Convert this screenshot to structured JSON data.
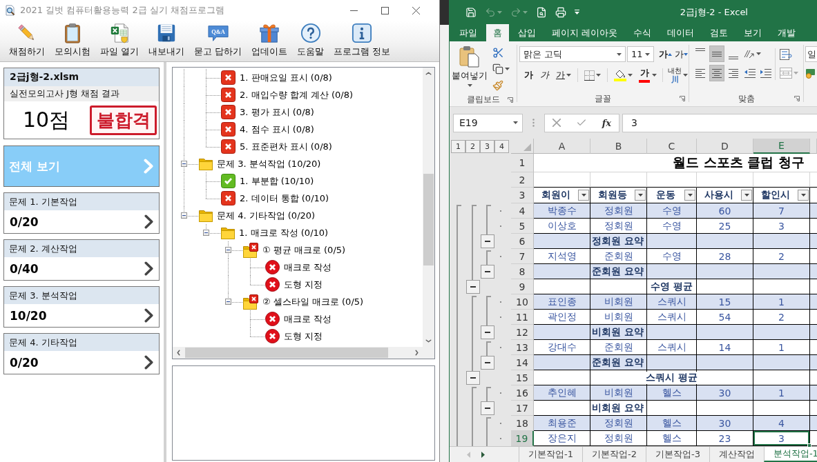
{
  "app": {
    "title": "2021 길벗 컴퓨터활용능력 2급 실기 채점프로그램",
    "toolbar": [
      {
        "kind": "pencil",
        "label": "채점하기"
      },
      {
        "kind": "clipboard",
        "label": "모의시험"
      },
      {
        "kind": "spreadsheet",
        "label": "파일 열기"
      },
      {
        "kind": "disk",
        "label": "내보내기"
      },
      {
        "kind": "qa",
        "icon_text": "Q&A",
        "label": "묻고 답하기"
      },
      {
        "kind": "gift",
        "label": "업데이트"
      },
      {
        "kind": "help",
        "label": "도움말"
      },
      {
        "kind": "info",
        "label": "프로그램 정보"
      }
    ],
    "result": {
      "file": "2급j형-2.xlsm",
      "subtitle": "실전모의고사 J형 채점 결과",
      "score": "10점",
      "stamp": "불합격"
    },
    "overview": "전체 보기",
    "sections": [
      {
        "title": "문제 1. 기본작업",
        "score": "0/20"
      },
      {
        "title": "문제 2. 계산작업",
        "score": "0/40"
      },
      {
        "title": "문제 3. 분석작업",
        "score": "10/20"
      },
      {
        "title": "문제 4. 기타작업",
        "score": "0/20"
      }
    ],
    "tree": {
      "items": [
        {
          "children": [
            {
              "kind": "error-square",
              "label": "1. 판매요일 표시 (0/8)"
            },
            {
              "kind": "error-square",
              "label": "2. 매입수량 합계 계산 (0/8)"
            },
            {
              "kind": "error-square",
              "label": "3. 평가 표시 (0/8)"
            },
            {
              "kind": "error-square",
              "label": "4. 점수 표시 (0/8)"
            },
            {
              "kind": "error-square",
              "label": "5. 표준편차 표시 (0/8)"
            }
          ]
        },
        {
          "kind": "folder",
          "label": "문제 3. 분석작업 (10/20)",
          "expanded": true,
          "children": [
            {
              "kind": "ok-square",
              "label": "1. 부분합 (10/10)"
            },
            {
              "kind": "error-square",
              "label": "2. 데이터 통합 (0/10)"
            }
          ]
        },
        {
          "kind": "folder",
          "label": "문제 4. 기타작업 (0/20)",
          "expanded": true,
          "children": [
            {
              "kind": "folder",
              "label": "1. 매크로 작성 (0/10)",
              "expanded": true,
              "children": [
                {
                  "kind": "folder-error",
                  "label": "① 평균 매크로 (0/5)",
                  "expanded": true,
                  "children": [
                    {
                      "kind": "error-round",
                      "label": "매크로 작성"
                    },
                    {
                      "kind": "error-round",
                      "label": "도형 지정"
                    }
                  ]
                },
                {
                  "kind": "folder-error",
                  "label": "② 셀스타일 매크로 (0/5)",
                  "expanded": true,
                  "children": [
                    {
                      "kind": "error-round",
                      "label": "매크로 작성"
                    },
                    {
                      "kind": "error-round",
                      "label": "도형 지정"
                    }
                  ]
                }
              ]
            }
          ]
        }
      ]
    }
  },
  "excel": {
    "quick_access": [
      {
        "kind": "save",
        "disabled": false
      },
      {
        "kind": "undo",
        "disabled": true
      },
      {
        "kind": "redo",
        "disabled": true
      },
      {
        "kind": "print-preview",
        "disabled": false
      },
      {
        "kind": "print",
        "disabled": false
      },
      {
        "kind": "customize",
        "disabled": false
      }
    ],
    "title": "2급j형-2 - Excel",
    "tabs": [
      {
        "label": "파일",
        "selected": false
      },
      {
        "label": "홈",
        "selected": true
      },
      {
        "label": "삽입",
        "selected": false
      },
      {
        "label": "페이지 레이아웃",
        "selected": false
      },
      {
        "label": "수식",
        "selected": false
      },
      {
        "label": "데이터",
        "selected": false
      },
      {
        "label": "검토",
        "selected": false
      },
      {
        "label": "보기",
        "selected": false
      },
      {
        "label": "개발",
        "selected": false
      }
    ],
    "ribbon": {
      "clipboard": {
        "paste": "붙여넣기",
        "label": "클립보드"
      },
      "font": {
        "name": "맑은 고딕",
        "size": "11",
        "grow": "가",
        "shrink": "가",
        "bold": "가",
        "italic": "가",
        "underline": "가",
        "font_color": "가",
        "phonetic": "내천",
        "phonetic_mark": "川",
        "label": "글꼴"
      },
      "alignment": {
        "vertical": [
          {
            "kind": "top",
            "selected": false
          },
          {
            "kind": "middle",
            "selected": true
          },
          {
            "kind": "bottom",
            "selected": false
          }
        ],
        "horizontal": [
          {
            "kind": "left",
            "selected": false
          },
          {
            "kind": "center",
            "selected": true
          },
          {
            "kind": "right",
            "selected": false
          }
        ],
        "label": "맞춤"
      },
      "number": {
        "format": "일"
      }
    },
    "name_box": "E19",
    "function_label": "fx",
    "formula": "3",
    "outline_levels": [
      "1",
      "2",
      "3",
      "4"
    ],
    "columns": [
      {
        "label": "A",
        "selected": false
      },
      {
        "label": "B",
        "selected": false
      },
      {
        "label": "C",
        "selected": false
      },
      {
        "label": "D",
        "selected": false
      },
      {
        "label": "E",
        "selected": true
      }
    ],
    "rows": [
      {
        "number": "1",
        "kind": "title",
        "label": "월드 스포츠 클럽 청구",
        "selected": false
      },
      {
        "number": "2",
        "kind": "blank",
        "selected": false
      },
      {
        "number": "3",
        "kind": "header",
        "cells": [
          "회원이",
          "회원등",
          "운동",
          "사용시",
          "할인시"
        ],
        "selected": false
      },
      {
        "number": "4",
        "kind": "detail",
        "cells": [
          "박종수",
          "정회원",
          "수영",
          "60",
          "7"
        ],
        "selected": false
      },
      {
        "number": "5",
        "kind": "detail",
        "cells": [
          "이상호",
          "정회원",
          "수영",
          "25",
          "3"
        ],
        "selected": false
      },
      {
        "number": "6",
        "kind": "subtotal",
        "label": "정회원 요약",
        "selected": false
      },
      {
        "number": "7",
        "kind": "detail",
        "cells": [
          "지석영",
          "준회원",
          "수영",
          "28",
          "2"
        ],
        "selected": false
      },
      {
        "number": "8",
        "kind": "subtotal",
        "label": "준회원 요약",
        "selected": false
      },
      {
        "number": "9",
        "kind": "average",
        "label": "수영 평균",
        "selected": false
      },
      {
        "number": "10",
        "kind": "detail",
        "cells": [
          "표인종",
          "비회원",
          "스쿼시",
          "15",
          "1"
        ],
        "selected": false
      },
      {
        "number": "11",
        "kind": "detail",
        "cells": [
          "곽인정",
          "비회원",
          "스쿼시",
          "54",
          "2"
        ],
        "selected": false
      },
      {
        "number": "12",
        "kind": "subtotal",
        "label": "비회원 요약",
        "selected": false
      },
      {
        "number": "13",
        "kind": "detail",
        "cells": [
          "강대수",
          "준회원",
          "스쿼시",
          "14",
          "1"
        ],
        "selected": false
      },
      {
        "number": "14",
        "kind": "subtotal",
        "label": "준회원 요약",
        "selected": false
      },
      {
        "number": "15",
        "kind": "average",
        "label": "스쿼시 평균",
        "selected": false
      },
      {
        "number": "16",
        "kind": "detail",
        "cells": [
          "추인혜",
          "비회원",
          "헬스",
          "30",
          "1"
        ],
        "selected": false
      },
      {
        "number": "17",
        "kind": "subtotal",
        "label": "비회원 요약",
        "selected": false
      },
      {
        "number": "18",
        "kind": "detail",
        "cells": [
          "최용준",
          "정회원",
          "헬스",
          "30",
          "4"
        ],
        "selected": false
      },
      {
        "number": "19",
        "kind": "detail",
        "cells": [
          "장은지",
          "정회원",
          "헬스",
          "23",
          "3"
        ],
        "selected": true
      }
    ],
    "sheet_tabs": [
      {
        "label": "기본작업-1",
        "selected": false
      },
      {
        "label": "기본작업-2",
        "selected": false
      },
      {
        "label": "기본작업-3",
        "selected": false
      },
      {
        "label": "계산작업",
        "selected": false
      },
      {
        "label": "분석작업-1",
        "selected": true
      }
    ]
  }
}
